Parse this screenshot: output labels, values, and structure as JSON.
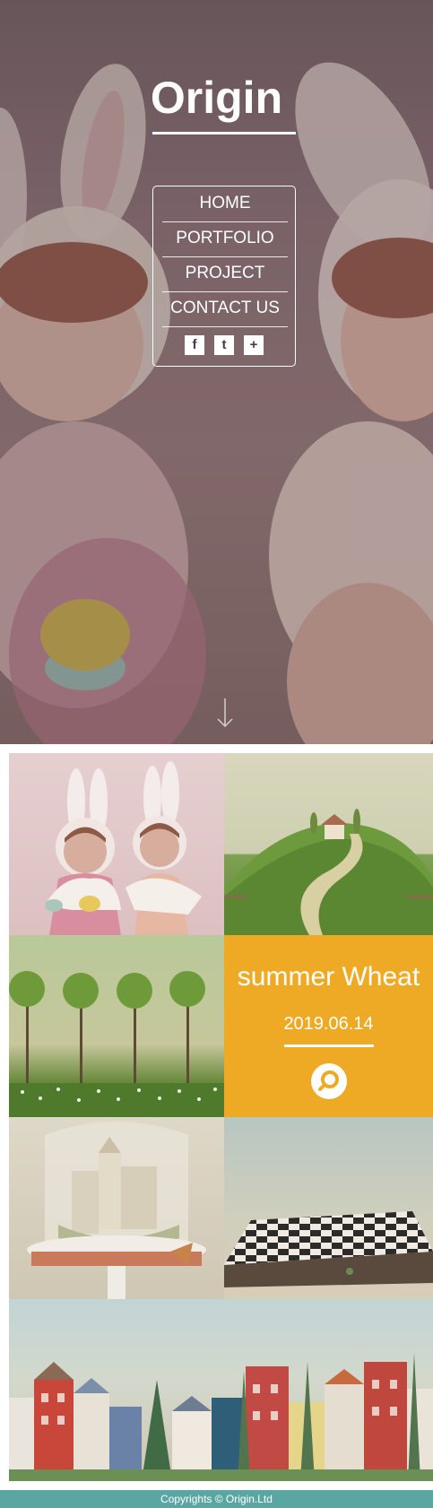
{
  "header": {
    "logo_text": "Origin"
  },
  "nav": {
    "items": [
      {
        "label": "HOME"
      },
      {
        "label": "PORTFOLIO"
      },
      {
        "label": "PROJECT"
      },
      {
        "label": "CONTACT US"
      }
    ],
    "social": [
      {
        "icon": "facebook-icon",
        "glyph": "f"
      },
      {
        "icon": "twitter-icon",
        "glyph": "t"
      },
      {
        "icon": "plus-icon",
        "glyph": "+"
      }
    ]
  },
  "hero": {
    "scroll_icon": "arrow-down-icon"
  },
  "gallery": {
    "featured": {
      "title": "summer Wheat",
      "date": "2019.06.14",
      "icon": "search-icon"
    }
  },
  "footer": {
    "copyright": "Copyrights © Origin.Ltd"
  },
  "colors": {
    "accent": "#eeaa24",
    "footer_bg": "#5aa6a3"
  }
}
